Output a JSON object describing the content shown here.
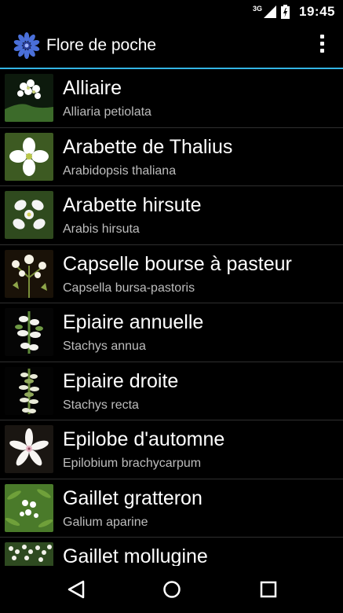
{
  "status_bar": {
    "network": "3G",
    "time": "19:45"
  },
  "app_bar": {
    "title": "Flore de poche",
    "logo_icon": "cornflower-logo-icon",
    "overflow_icon": "overflow-menu-icon"
  },
  "plants": [
    {
      "name": "Alliaire",
      "latin": "Alliaria petiolata"
    },
    {
      "name": "Arabette de Thalius",
      "latin": "Arabidopsis thaliana"
    },
    {
      "name": "Arabette hirsute",
      "latin": "Arabis hirsuta"
    },
    {
      "name": "Capselle bourse à pasteur",
      "latin": "Capsella bursa-pastoris"
    },
    {
      "name": "Epiaire annuelle",
      "latin": "Stachys annua"
    },
    {
      "name": "Epiaire droite",
      "latin": "Stachys recta"
    },
    {
      "name": "Epilobe d'automne",
      "latin": "Epilobium brachycarpum"
    },
    {
      "name": "Gaillet gratteron",
      "latin": "Galium aparine"
    },
    {
      "name": "Gaillet mollugine",
      "latin": ""
    }
  ],
  "nav_bar": {
    "back_icon": "back-icon",
    "home_icon": "home-icon",
    "recents_icon": "recents-icon"
  },
  "colors": {
    "accent": "#33b5e5",
    "background": "#000000",
    "secondary_text": "#bdbdbd"
  }
}
